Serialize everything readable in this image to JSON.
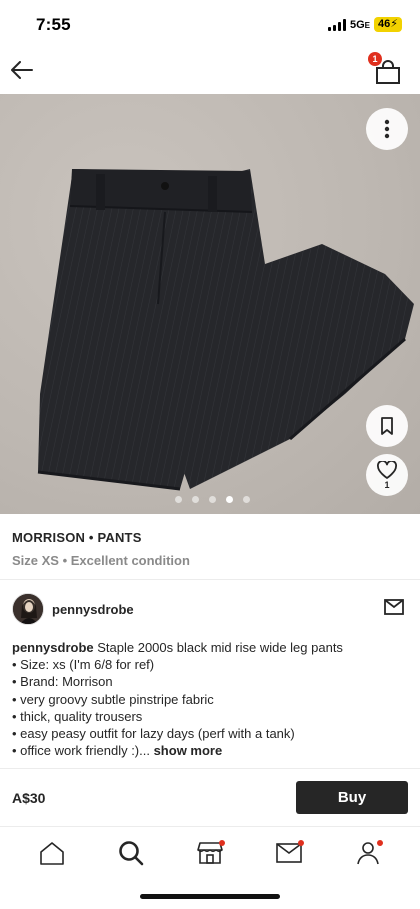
{
  "status_bar": {
    "time": "7:55",
    "network": "5G",
    "network_suffix": "E",
    "battery": "46"
  },
  "header": {
    "back_icon": "arrow-left-icon",
    "bag_icon": "shopping-bag-icon",
    "bag_count": "1"
  },
  "gallery": {
    "image_count": 5,
    "active_index": 3,
    "like_count": "1",
    "more_icon": "more-vertical-icon",
    "save_icon": "bookmark-icon",
    "like_icon": "heart-icon"
  },
  "product": {
    "title": "MORRISON • PANTS",
    "details": "Size XS • Excellent condition"
  },
  "seller": {
    "username": "pennysdrobe",
    "message_icon": "envelope-icon"
  },
  "description": {
    "username": "pennysdrobe",
    "first_line_text": " Staple 2000s black mid rise wide leg pants",
    "lines": [
      "• Size: xs   (I'm 6/8 for ref)",
      "• Brand: Morrison",
      "• very groovy subtle pinstripe fabric",
      "• thick, quality trousers",
      "• easy peasy outfit for lazy days (perf with a tank)"
    ],
    "last_line": "• office work friendly :)... ",
    "show_more": "show more"
  },
  "purchase": {
    "price": "A$30",
    "buy_label": "Buy"
  },
  "tab_bar": {
    "items": [
      {
        "icon": "home-icon",
        "badge": false
      },
      {
        "icon": "search-icon",
        "badge": false
      },
      {
        "icon": "shop-icon",
        "badge": true
      },
      {
        "icon": "inbox-icon",
        "badge": true
      },
      {
        "icon": "profile-icon",
        "badge": true
      }
    ]
  },
  "colors": {
    "accent": "#e0301e",
    "text": "#262626",
    "muted": "#8a8a8a",
    "battery": "#f2d200"
  }
}
